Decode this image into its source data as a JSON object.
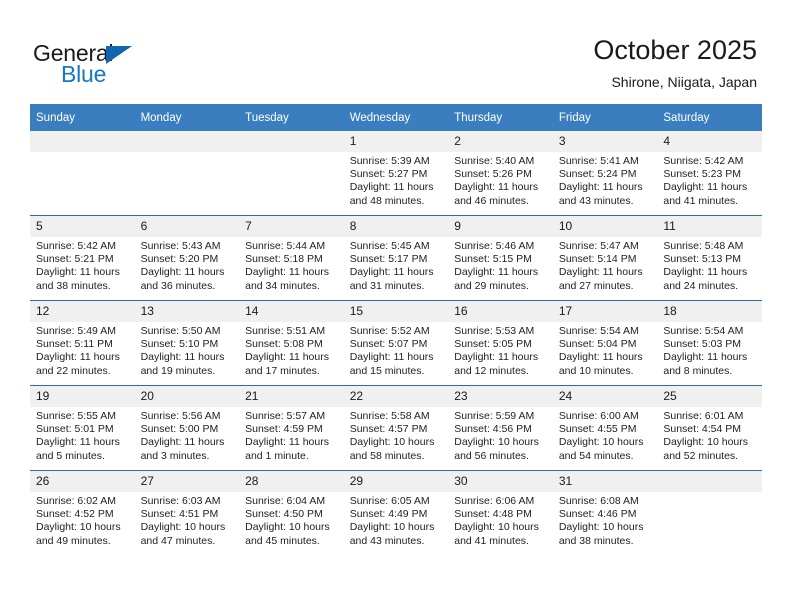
{
  "logo": {
    "word_one": "General",
    "word_two": "Blue",
    "triangle_color": "#1266b0",
    "blue_color": "#1777c4"
  },
  "header": {
    "month_title": "October 2025",
    "location": "Shirone, Niigata, Japan"
  },
  "theme": {
    "header_bg": "#3a7ebf",
    "week_divider": "#2e6da4",
    "daynum_bg": "#f0f0f0"
  },
  "weekday_headers": [
    "Sunday",
    "Monday",
    "Tuesday",
    "Wednesday",
    "Thursday",
    "Friday",
    "Saturday"
  ],
  "weeks": [
    [
      {
        "day": "",
        "blank": true,
        "sunrise": "",
        "sunset": "",
        "daylight": ""
      },
      {
        "day": "",
        "blank": true,
        "sunrise": "",
        "sunset": "",
        "daylight": ""
      },
      {
        "day": "",
        "blank": true,
        "sunrise": "",
        "sunset": "",
        "daylight": ""
      },
      {
        "day": "1",
        "blank": false,
        "sunrise": "Sunrise: 5:39 AM",
        "sunset": "Sunset: 5:27 PM",
        "daylight": "Daylight: 11 hours and 48 minutes."
      },
      {
        "day": "2",
        "blank": false,
        "sunrise": "Sunrise: 5:40 AM",
        "sunset": "Sunset: 5:26 PM",
        "daylight": "Daylight: 11 hours and 46 minutes."
      },
      {
        "day": "3",
        "blank": false,
        "sunrise": "Sunrise: 5:41 AM",
        "sunset": "Sunset: 5:24 PM",
        "daylight": "Daylight: 11 hours and 43 minutes."
      },
      {
        "day": "4",
        "blank": false,
        "sunrise": "Sunrise: 5:42 AM",
        "sunset": "Sunset: 5:23 PM",
        "daylight": "Daylight: 11 hours and 41 minutes."
      }
    ],
    [
      {
        "day": "5",
        "blank": false,
        "sunrise": "Sunrise: 5:42 AM",
        "sunset": "Sunset: 5:21 PM",
        "daylight": "Daylight: 11 hours and 38 minutes."
      },
      {
        "day": "6",
        "blank": false,
        "sunrise": "Sunrise: 5:43 AM",
        "sunset": "Sunset: 5:20 PM",
        "daylight": "Daylight: 11 hours and 36 minutes."
      },
      {
        "day": "7",
        "blank": false,
        "sunrise": "Sunrise: 5:44 AM",
        "sunset": "Sunset: 5:18 PM",
        "daylight": "Daylight: 11 hours and 34 minutes."
      },
      {
        "day": "8",
        "blank": false,
        "sunrise": "Sunrise: 5:45 AM",
        "sunset": "Sunset: 5:17 PM",
        "daylight": "Daylight: 11 hours and 31 minutes."
      },
      {
        "day": "9",
        "blank": false,
        "sunrise": "Sunrise: 5:46 AM",
        "sunset": "Sunset: 5:15 PM",
        "daylight": "Daylight: 11 hours and 29 minutes."
      },
      {
        "day": "10",
        "blank": false,
        "sunrise": "Sunrise: 5:47 AM",
        "sunset": "Sunset: 5:14 PM",
        "daylight": "Daylight: 11 hours and 27 minutes."
      },
      {
        "day": "11",
        "blank": false,
        "sunrise": "Sunrise: 5:48 AM",
        "sunset": "Sunset: 5:13 PM",
        "daylight": "Daylight: 11 hours and 24 minutes."
      }
    ],
    [
      {
        "day": "12",
        "blank": false,
        "sunrise": "Sunrise: 5:49 AM",
        "sunset": "Sunset: 5:11 PM",
        "daylight": "Daylight: 11 hours and 22 minutes."
      },
      {
        "day": "13",
        "blank": false,
        "sunrise": "Sunrise: 5:50 AM",
        "sunset": "Sunset: 5:10 PM",
        "daylight": "Daylight: 11 hours and 19 minutes."
      },
      {
        "day": "14",
        "blank": false,
        "sunrise": "Sunrise: 5:51 AM",
        "sunset": "Sunset: 5:08 PM",
        "daylight": "Daylight: 11 hours and 17 minutes."
      },
      {
        "day": "15",
        "blank": false,
        "sunrise": "Sunrise: 5:52 AM",
        "sunset": "Sunset: 5:07 PM",
        "daylight": "Daylight: 11 hours and 15 minutes."
      },
      {
        "day": "16",
        "blank": false,
        "sunrise": "Sunrise: 5:53 AM",
        "sunset": "Sunset: 5:05 PM",
        "daylight": "Daylight: 11 hours and 12 minutes."
      },
      {
        "day": "17",
        "blank": false,
        "sunrise": "Sunrise: 5:54 AM",
        "sunset": "Sunset: 5:04 PM",
        "daylight": "Daylight: 11 hours and 10 minutes."
      },
      {
        "day": "18",
        "blank": false,
        "sunrise": "Sunrise: 5:54 AM",
        "sunset": "Sunset: 5:03 PM",
        "daylight": "Daylight: 11 hours and 8 minutes."
      }
    ],
    [
      {
        "day": "19",
        "blank": false,
        "sunrise": "Sunrise: 5:55 AM",
        "sunset": "Sunset: 5:01 PM",
        "daylight": "Daylight: 11 hours and 5 minutes."
      },
      {
        "day": "20",
        "blank": false,
        "sunrise": "Sunrise: 5:56 AM",
        "sunset": "Sunset: 5:00 PM",
        "daylight": "Daylight: 11 hours and 3 minutes."
      },
      {
        "day": "21",
        "blank": false,
        "sunrise": "Sunrise: 5:57 AM",
        "sunset": "Sunset: 4:59 PM",
        "daylight": "Daylight: 11 hours and 1 minute."
      },
      {
        "day": "22",
        "blank": false,
        "sunrise": "Sunrise: 5:58 AM",
        "sunset": "Sunset: 4:57 PM",
        "daylight": "Daylight: 10 hours and 58 minutes."
      },
      {
        "day": "23",
        "blank": false,
        "sunrise": "Sunrise: 5:59 AM",
        "sunset": "Sunset: 4:56 PM",
        "daylight": "Daylight: 10 hours and 56 minutes."
      },
      {
        "day": "24",
        "blank": false,
        "sunrise": "Sunrise: 6:00 AM",
        "sunset": "Sunset: 4:55 PM",
        "daylight": "Daylight: 10 hours and 54 minutes."
      },
      {
        "day": "25",
        "blank": false,
        "sunrise": "Sunrise: 6:01 AM",
        "sunset": "Sunset: 4:54 PM",
        "daylight": "Daylight: 10 hours and 52 minutes."
      }
    ],
    [
      {
        "day": "26",
        "blank": false,
        "sunrise": "Sunrise: 6:02 AM",
        "sunset": "Sunset: 4:52 PM",
        "daylight": "Daylight: 10 hours and 49 minutes."
      },
      {
        "day": "27",
        "blank": false,
        "sunrise": "Sunrise: 6:03 AM",
        "sunset": "Sunset: 4:51 PM",
        "daylight": "Daylight: 10 hours and 47 minutes."
      },
      {
        "day": "28",
        "blank": false,
        "sunrise": "Sunrise: 6:04 AM",
        "sunset": "Sunset: 4:50 PM",
        "daylight": "Daylight: 10 hours and 45 minutes."
      },
      {
        "day": "29",
        "blank": false,
        "sunrise": "Sunrise: 6:05 AM",
        "sunset": "Sunset: 4:49 PM",
        "daylight": "Daylight: 10 hours and 43 minutes."
      },
      {
        "day": "30",
        "blank": false,
        "sunrise": "Sunrise: 6:06 AM",
        "sunset": "Sunset: 4:48 PM",
        "daylight": "Daylight: 10 hours and 41 minutes."
      },
      {
        "day": "31",
        "blank": false,
        "sunrise": "Sunrise: 6:08 AM",
        "sunset": "Sunset: 4:46 PM",
        "daylight": "Daylight: 10 hours and 38 minutes."
      },
      {
        "day": "",
        "blank": true,
        "sunrise": "",
        "sunset": "",
        "daylight": ""
      }
    ]
  ]
}
